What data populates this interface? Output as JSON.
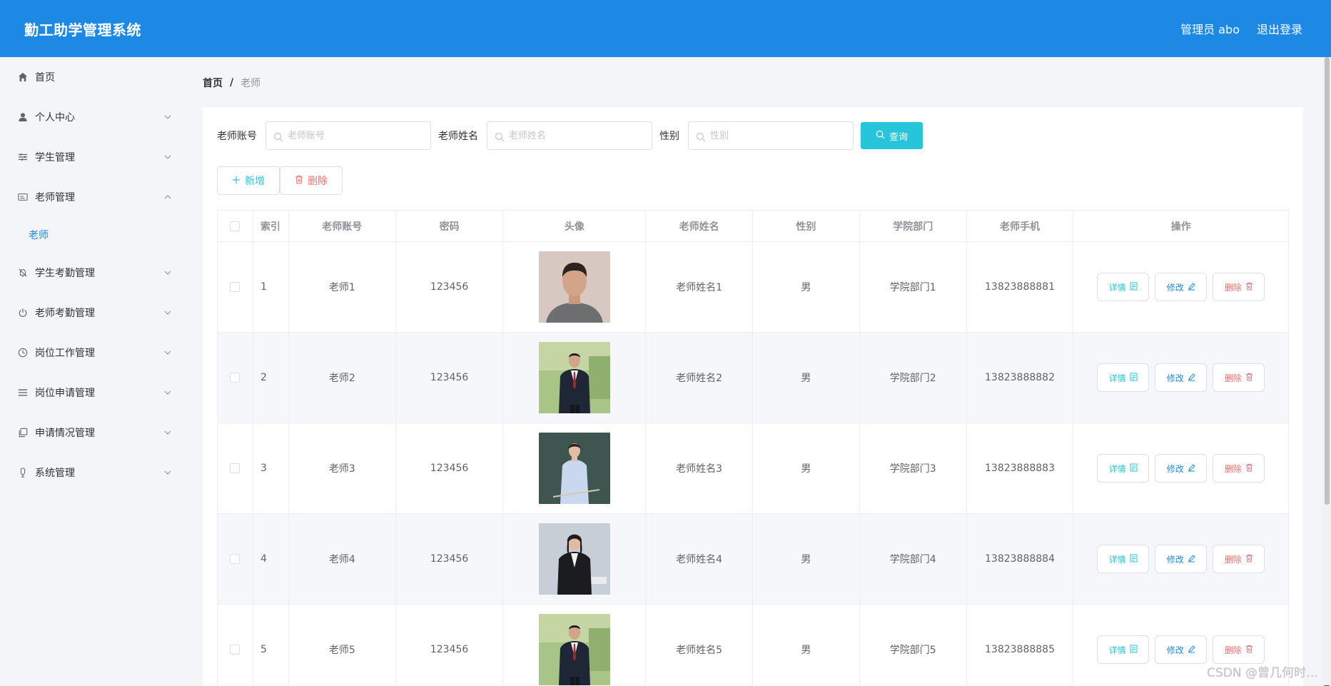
{
  "header": {
    "app_title": "勤工助学管理系统",
    "user_label": "管理员 abo",
    "logout_label": "退出登录"
  },
  "sidebar": {
    "items": [
      {
        "label": "首页",
        "icon": "home-icon"
      },
      {
        "label": "个人中心",
        "icon": "user-icon"
      },
      {
        "label": "学生管理",
        "icon": "sliders-icon"
      },
      {
        "label": "老师管理",
        "icon": "id-card-icon",
        "expanded": true
      },
      {
        "label": "学生考勤管理",
        "icon": "bell-off-icon"
      },
      {
        "label": "老师考勤管理",
        "icon": "power-icon"
      },
      {
        "label": "岗位工作管理",
        "icon": "clock-icon"
      },
      {
        "label": "岗位申请管理",
        "icon": "list-icon"
      },
      {
        "label": "申请情况管理",
        "icon": "copy-icon"
      },
      {
        "label": "系统管理",
        "icon": "mic-icon"
      }
    ],
    "sub_active": "老师"
  },
  "breadcrumb": {
    "home": "首页",
    "separator": "/",
    "current": "老师"
  },
  "search": {
    "account_label": "老师账号",
    "account_placeholder": "老师账号",
    "name_label": "老师姓名",
    "name_placeholder": "老师姓名",
    "gender_label": "性别",
    "gender_placeholder": "性别",
    "query_label": "查询"
  },
  "actions": {
    "add_label": "新增",
    "delete_label": "删除"
  },
  "table": {
    "columns": [
      "索引",
      "老师账号",
      "密码",
      "头像",
      "老师姓名",
      "性别",
      "学院部门",
      "老师手机",
      "操作"
    ],
    "rows": [
      {
        "index": "1",
        "account": "老师1",
        "password": "123456",
        "name": "老师姓名1",
        "gender": "男",
        "dept": "学院部门1",
        "phone": "13823888881"
      },
      {
        "index": "2",
        "account": "老师2",
        "password": "123456",
        "name": "老师姓名2",
        "gender": "男",
        "dept": "学院部门2",
        "phone": "13823888882"
      },
      {
        "index": "3",
        "account": "老师3",
        "password": "123456",
        "name": "老师姓名3",
        "gender": "男",
        "dept": "学院部门3",
        "phone": "13823888883"
      },
      {
        "index": "4",
        "account": "老师4",
        "password": "123456",
        "name": "老师姓名4",
        "gender": "男",
        "dept": "学院部门4",
        "phone": "13823888884"
      },
      {
        "index": "5",
        "account": "老师5",
        "password": "123456",
        "name": "老师姓名5",
        "gender": "男",
        "dept": "学院部门5",
        "phone": "13823888885"
      }
    ],
    "op_detail": "详情",
    "op_edit": "修改",
    "op_delete": "删除"
  },
  "watermark": "CSDN @曾几何时…",
  "colors": {
    "header_bg": "#1e88e5",
    "accent_cyan": "#26c5d9",
    "danger": "#f56c6c",
    "primary": "#1e88e5"
  }
}
